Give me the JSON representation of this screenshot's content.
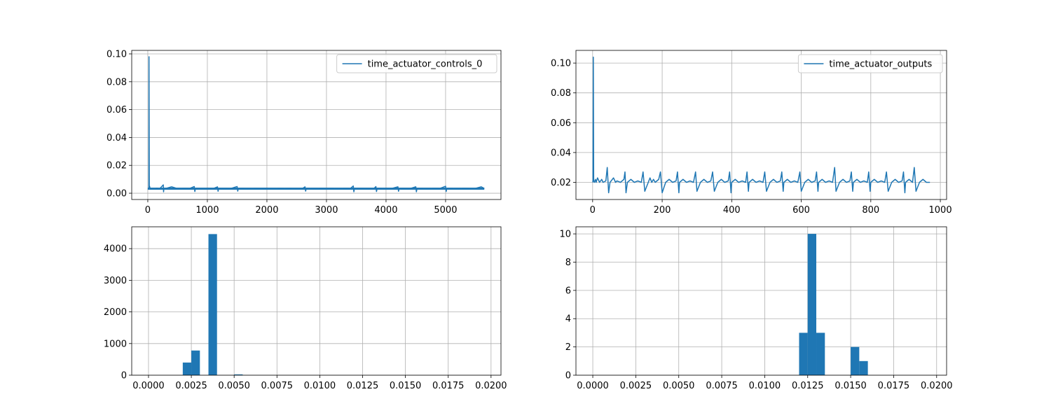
{
  "colors": {
    "series": "#1f77b4",
    "grid": "#b0b0b0",
    "axis": "#000000"
  },
  "chart_data": [
    {
      "type": "line",
      "title": "",
      "xlabel": "",
      "ylabel": "",
      "xlim": [
        -270,
        5930
      ],
      "ylim": [
        -0.0045,
        0.1025
      ],
      "xticks": [
        0,
        1000,
        2000,
        3000,
        4000,
        5000
      ],
      "xtick_labels": [
        "0",
        "1000",
        "2000",
        "3000",
        "4000",
        "5000"
      ],
      "yticks": [
        0.0,
        0.02,
        0.04,
        0.06,
        0.08,
        0.1
      ],
      "ytick_labels": [
        "0.00",
        "0.02",
        "0.04",
        "0.06",
        "0.08",
        "0.10"
      ],
      "grid": true,
      "legend": "upper-right",
      "series": [
        {
          "name": "time_actuator_controls_0",
          "baseline": [
            0.0025,
            0.004
          ],
          "x": [
            0,
            10,
            18,
            20,
            25,
            30,
            40,
            60,
            100,
            150,
            200,
            260,
            265,
            270,
            300,
            400,
            500,
            600,
            700,
            780,
            790,
            800,
            900,
            1000,
            1100,
            1170,
            1180,
            1190,
            1300,
            1400,
            1500,
            1510,
            1520,
            1600,
            1700,
            1800,
            1900,
            2000,
            2100,
            2200,
            2300,
            2400,
            2500,
            2600,
            2640,
            2650,
            2660,
            2700,
            2800,
            2900,
            3000,
            3100,
            3200,
            3300,
            3400,
            3450,
            3460,
            3470,
            3500,
            3600,
            3700,
            3800,
            3830,
            3840,
            3850,
            3900,
            4000,
            4100,
            4200,
            4210,
            4220,
            4300,
            4400,
            4500,
            4510,
            4520,
            4600,
            4700,
            4800,
            4900,
            5000,
            5010,
            5020,
            5100,
            5200,
            5300,
            5400,
            5500,
            5600,
            5650
          ],
          "y": [
            0.003,
            0.003,
            0.004,
            0.098,
            0.004,
            0.005,
            0.003,
            0.0035,
            0.0032,
            0.0036,
            0.0033,
            0.006,
            0.001,
            0.0035,
            0.0034,
            0.0046,
            0.0033,
            0.0035,
            0.0034,
            0.0048,
            0.0012,
            0.0035,
            0.0033,
            0.0035,
            0.0034,
            0.0046,
            0.0014,
            0.0035,
            0.0033,
            0.0035,
            0.0048,
            0.0015,
            0.0034,
            0.0035,
            0.0033,
            0.0035,
            0.0034,
            0.0035,
            0.0033,
            0.0035,
            0.0034,
            0.0035,
            0.0033,
            0.0035,
            0.0046,
            0.0015,
            0.0034,
            0.0035,
            0.0033,
            0.0035,
            0.0034,
            0.0035,
            0.0033,
            0.0035,
            0.0034,
            0.0052,
            0.001,
            0.0035,
            0.0034,
            0.0035,
            0.0033,
            0.0035,
            0.0048,
            0.0012,
            0.0034,
            0.0035,
            0.0033,
            0.0035,
            0.0046,
            0.0014,
            0.0034,
            0.0035,
            0.0033,
            0.0046,
            0.001,
            0.0034,
            0.0035,
            0.0033,
            0.0035,
            0.0034,
            0.005,
            0.0012,
            0.0034,
            0.0035,
            0.0033,
            0.0035,
            0.0034,
            0.0035,
            0.0046,
            0.0034
          ]
        }
      ]
    },
    {
      "type": "line",
      "title": "",
      "xlabel": "",
      "ylabel": "",
      "xlim": [
        -48,
        1018
      ],
      "ylim": [
        0.0085,
        0.1085
      ],
      "xticks": [
        0,
        200,
        400,
        600,
        800,
        1000
      ],
      "xtick_labels": [
        "0",
        "200",
        "400",
        "600",
        "800",
        "1000"
      ],
      "yticks": [
        0.02,
        0.04,
        0.06,
        0.08,
        0.1
      ],
      "ytick_labels": [
        "0.02",
        "0.04",
        "0.06",
        "0.08",
        "0.10"
      ],
      "grid": true,
      "legend": "upper-right",
      "series": [
        {
          "name": "time_actuator_outputs",
          "x": [
            0,
            1,
            2,
            3,
            5,
            8,
            10,
            14,
            20,
            26,
            30,
            38,
            42,
            46,
            50,
            60,
            66,
            70,
            80,
            90,
            93,
            96,
            100,
            110,
            120,
            130,
            140,
            145,
            150,
            160,
            165,
            170,
            175,
            180,
            190,
            195,
            200,
            210,
            220,
            230,
            240,
            244,
            248,
            250,
            260,
            270,
            280,
            290,
            296,
            300,
            310,
            320,
            330,
            340,
            345,
            350,
            360,
            370,
            380,
            390,
            394,
            398,
            400,
            410,
            420,
            430,
            440,
            444,
            448,
            450,
            460,
            470,
            480,
            490,
            495,
            500,
            510,
            520,
            530,
            540,
            544,
            548,
            550,
            560,
            570,
            580,
            590,
            596,
            600,
            610,
            620,
            630,
            640,
            644,
            648,
            650,
            660,
            670,
            680,
            690,
            696,
            700,
            710,
            720,
            730,
            740,
            744,
            748,
            750,
            760,
            770,
            780,
            790,
            794,
            798,
            800,
            810,
            820,
            830,
            840,
            845,
            850,
            860,
            870,
            880,
            890,
            894,
            898,
            900,
            910,
            920,
            925,
            930,
            940,
            950,
            960,
            970
          ],
          "y": [
            0.02,
            0.021,
            0.104,
            0.021,
            0.02,
            0.022,
            0.02,
            0.023,
            0.02,
            0.022,
            0.02,
            0.021,
            0.03,
            0.013,
            0.02,
            0.023,
            0.02,
            0.021,
            0.02,
            0.022,
            0.027,
            0.013,
            0.02,
            0.022,
            0.02,
            0.021,
            0.02,
            0.027,
            0.014,
            0.02,
            0.023,
            0.02,
            0.022,
            0.02,
            0.022,
            0.027,
            0.013,
            0.02,
            0.022,
            0.02,
            0.021,
            0.027,
            0.013,
            0.02,
            0.022,
            0.02,
            0.021,
            0.02,
            0.027,
            0.014,
            0.02,
            0.022,
            0.02,
            0.021,
            0.027,
            0.014,
            0.02,
            0.022,
            0.02,
            0.021,
            0.027,
            0.013,
            0.02,
            0.022,
            0.02,
            0.021,
            0.02,
            0.027,
            0.014,
            0.02,
            0.022,
            0.02,
            0.021,
            0.02,
            0.027,
            0.014,
            0.02,
            0.022,
            0.02,
            0.021,
            0.027,
            0.014,
            0.02,
            0.022,
            0.02,
            0.021,
            0.02,
            0.027,
            0.014,
            0.02,
            0.022,
            0.02,
            0.021,
            0.027,
            0.014,
            0.02,
            0.022,
            0.02,
            0.021,
            0.02,
            0.03,
            0.014,
            0.02,
            0.022,
            0.02,
            0.021,
            0.027,
            0.014,
            0.02,
            0.022,
            0.02,
            0.021,
            0.02,
            0.027,
            0.014,
            0.02,
            0.022,
            0.02,
            0.021,
            0.02,
            0.027,
            0.014,
            0.02,
            0.022,
            0.02,
            0.021,
            0.027,
            0.013,
            0.02,
            0.022,
            0.02,
            0.03,
            0.014,
            0.02,
            0.022,
            0.02,
            0.02
          ]
        }
      ]
    },
    {
      "type": "bar",
      "title": "",
      "xlabel": "",
      "ylabel": "",
      "xlim": [
        -0.00098,
        0.02058
      ],
      "ylim": [
        0,
        4690
      ],
      "xticks": [
        0.0,
        0.0025,
        0.005,
        0.0075,
        0.01,
        0.0125,
        0.015,
        0.0175,
        0.02
      ],
      "xtick_labels": [
        "0.0000",
        "0.0025",
        "0.0050",
        "0.0075",
        "0.0100",
        "0.0125",
        "0.0150",
        "0.0175",
        "0.0200"
      ],
      "yticks": [
        0,
        1000,
        2000,
        3000,
        4000
      ],
      "ytick_labels": [
        "0",
        "1000",
        "2000",
        "3000",
        "4000"
      ],
      "grid": true,
      "bin_width": 0.0005,
      "bins": [
        0.002,
        0.0025,
        0.0035,
        0.005
      ],
      "values": [
        400,
        780,
        4460,
        25
      ]
    },
    {
      "type": "bar",
      "title": "",
      "xlabel": "",
      "ylabel": "",
      "xlim": [
        -0.00098,
        0.02058
      ],
      "ylim": [
        0,
        10.5
      ],
      "xticks": [
        0.0,
        0.0025,
        0.005,
        0.0075,
        0.01,
        0.0125,
        0.015,
        0.0175,
        0.02
      ],
      "xtick_labels": [
        "0.0000",
        "0.0025",
        "0.0050",
        "0.0075",
        "0.0100",
        "0.0125",
        "0.0150",
        "0.0175",
        "0.0200"
      ],
      "yticks": [
        0,
        2,
        4,
        6,
        8,
        10
      ],
      "ytick_labels": [
        "0",
        "2",
        "4",
        "6",
        "8",
        "10"
      ],
      "grid": true,
      "bin_width": 0.0005,
      "bins": [
        0.012,
        0.0125,
        0.013,
        0.015,
        0.0155
      ],
      "values": [
        3,
        10,
        3,
        2,
        1
      ]
    }
  ]
}
